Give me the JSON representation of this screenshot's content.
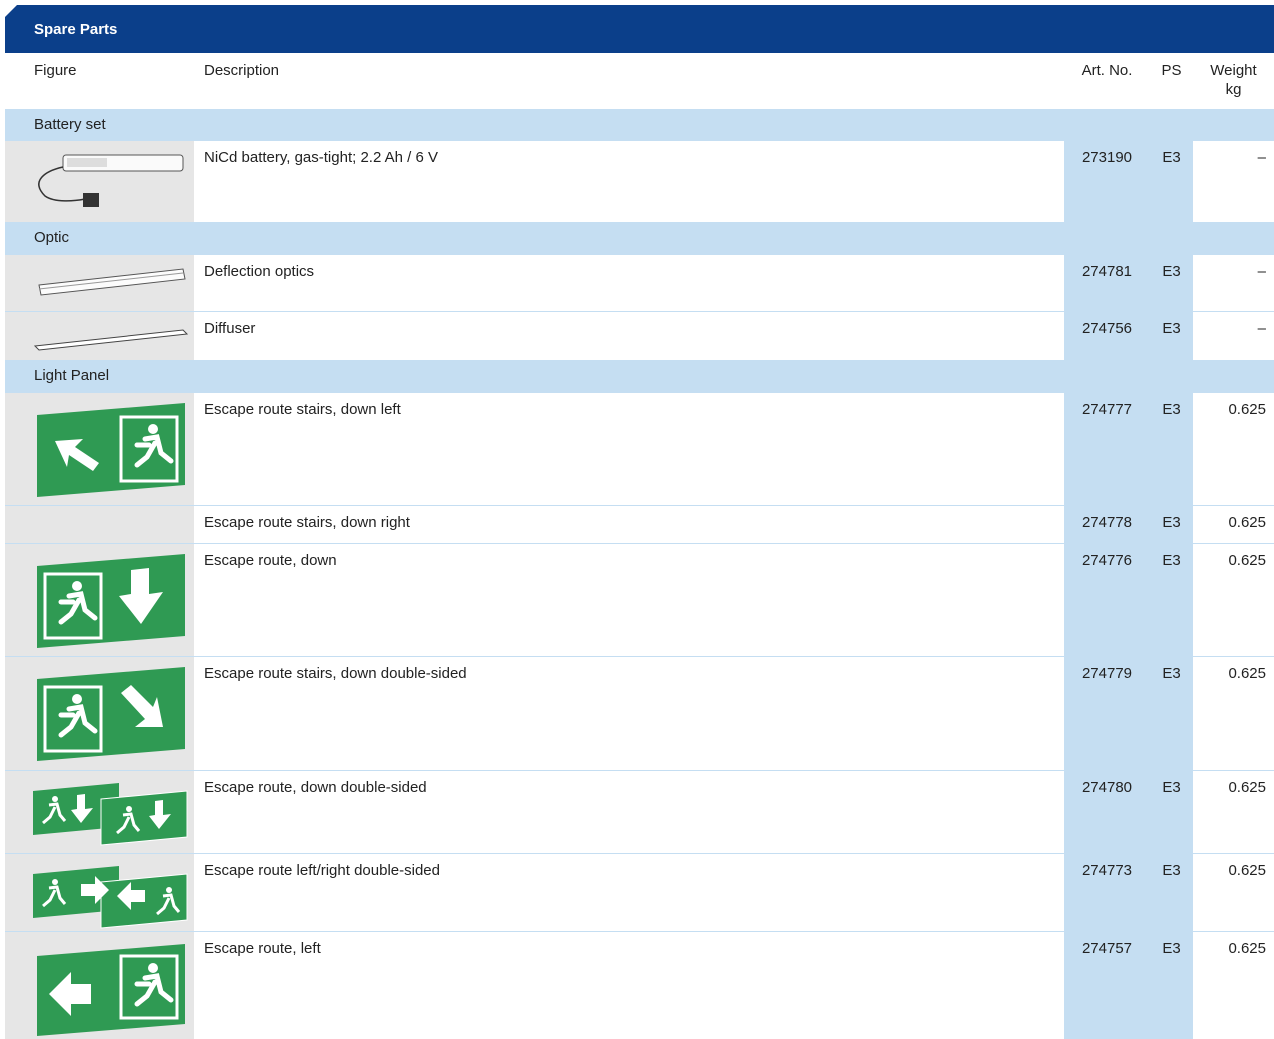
{
  "header": {
    "title": "Spare Parts"
  },
  "columns": {
    "figure": "Figure",
    "description": "Description",
    "art_no": "Art. No.",
    "ps": "PS",
    "weight": "Weight",
    "weight_unit": "kg"
  },
  "sections": [
    {
      "title": "Battery set",
      "items": [
        {
          "description": "NiCd battery, gas-tight; 2.2 Ah / 6 V",
          "art_no": "273190",
          "ps": "E3",
          "weight": "–"
        }
      ]
    },
    {
      "title": "Optic",
      "items": [
        {
          "description": "Deflection optics",
          "art_no": "274781",
          "ps": "E3",
          "weight": "–"
        },
        {
          "description": "Diffuser",
          "art_no": "274756",
          "ps": "E3",
          "weight": "–"
        }
      ]
    },
    {
      "title": "Light Panel",
      "items": [
        {
          "description": "Escape route stairs, down left",
          "art_no": "274777",
          "ps": "E3",
          "weight": "0.625"
        },
        {
          "description": "Escape route stairs, down right",
          "art_no": "274778",
          "ps": "E3",
          "weight": "0.625"
        },
        {
          "description": "Escape route, down",
          "art_no": "274776",
          "ps": "E3",
          "weight": "0.625"
        },
        {
          "description": "Escape route stairs, down double-sided",
          "art_no": "274779",
          "ps": "E3",
          "weight": "0.625"
        },
        {
          "description": "Escape route, down double-sided",
          "art_no": "274780",
          "ps": "E3",
          "weight": "0.625"
        },
        {
          "description": "Escape route left/right double-sided",
          "art_no": "274773",
          "ps": "E3",
          "weight": "0.625"
        },
        {
          "description": "Escape route, left",
          "art_no": "274757",
          "ps": "E3",
          "weight": "0.625"
        }
      ]
    }
  ],
  "colors": {
    "header_bg": "#0b3f8a",
    "light_blue": "#c5def2",
    "figure_bg": "#e6e6e6",
    "sign_green": "#2f9a53"
  }
}
